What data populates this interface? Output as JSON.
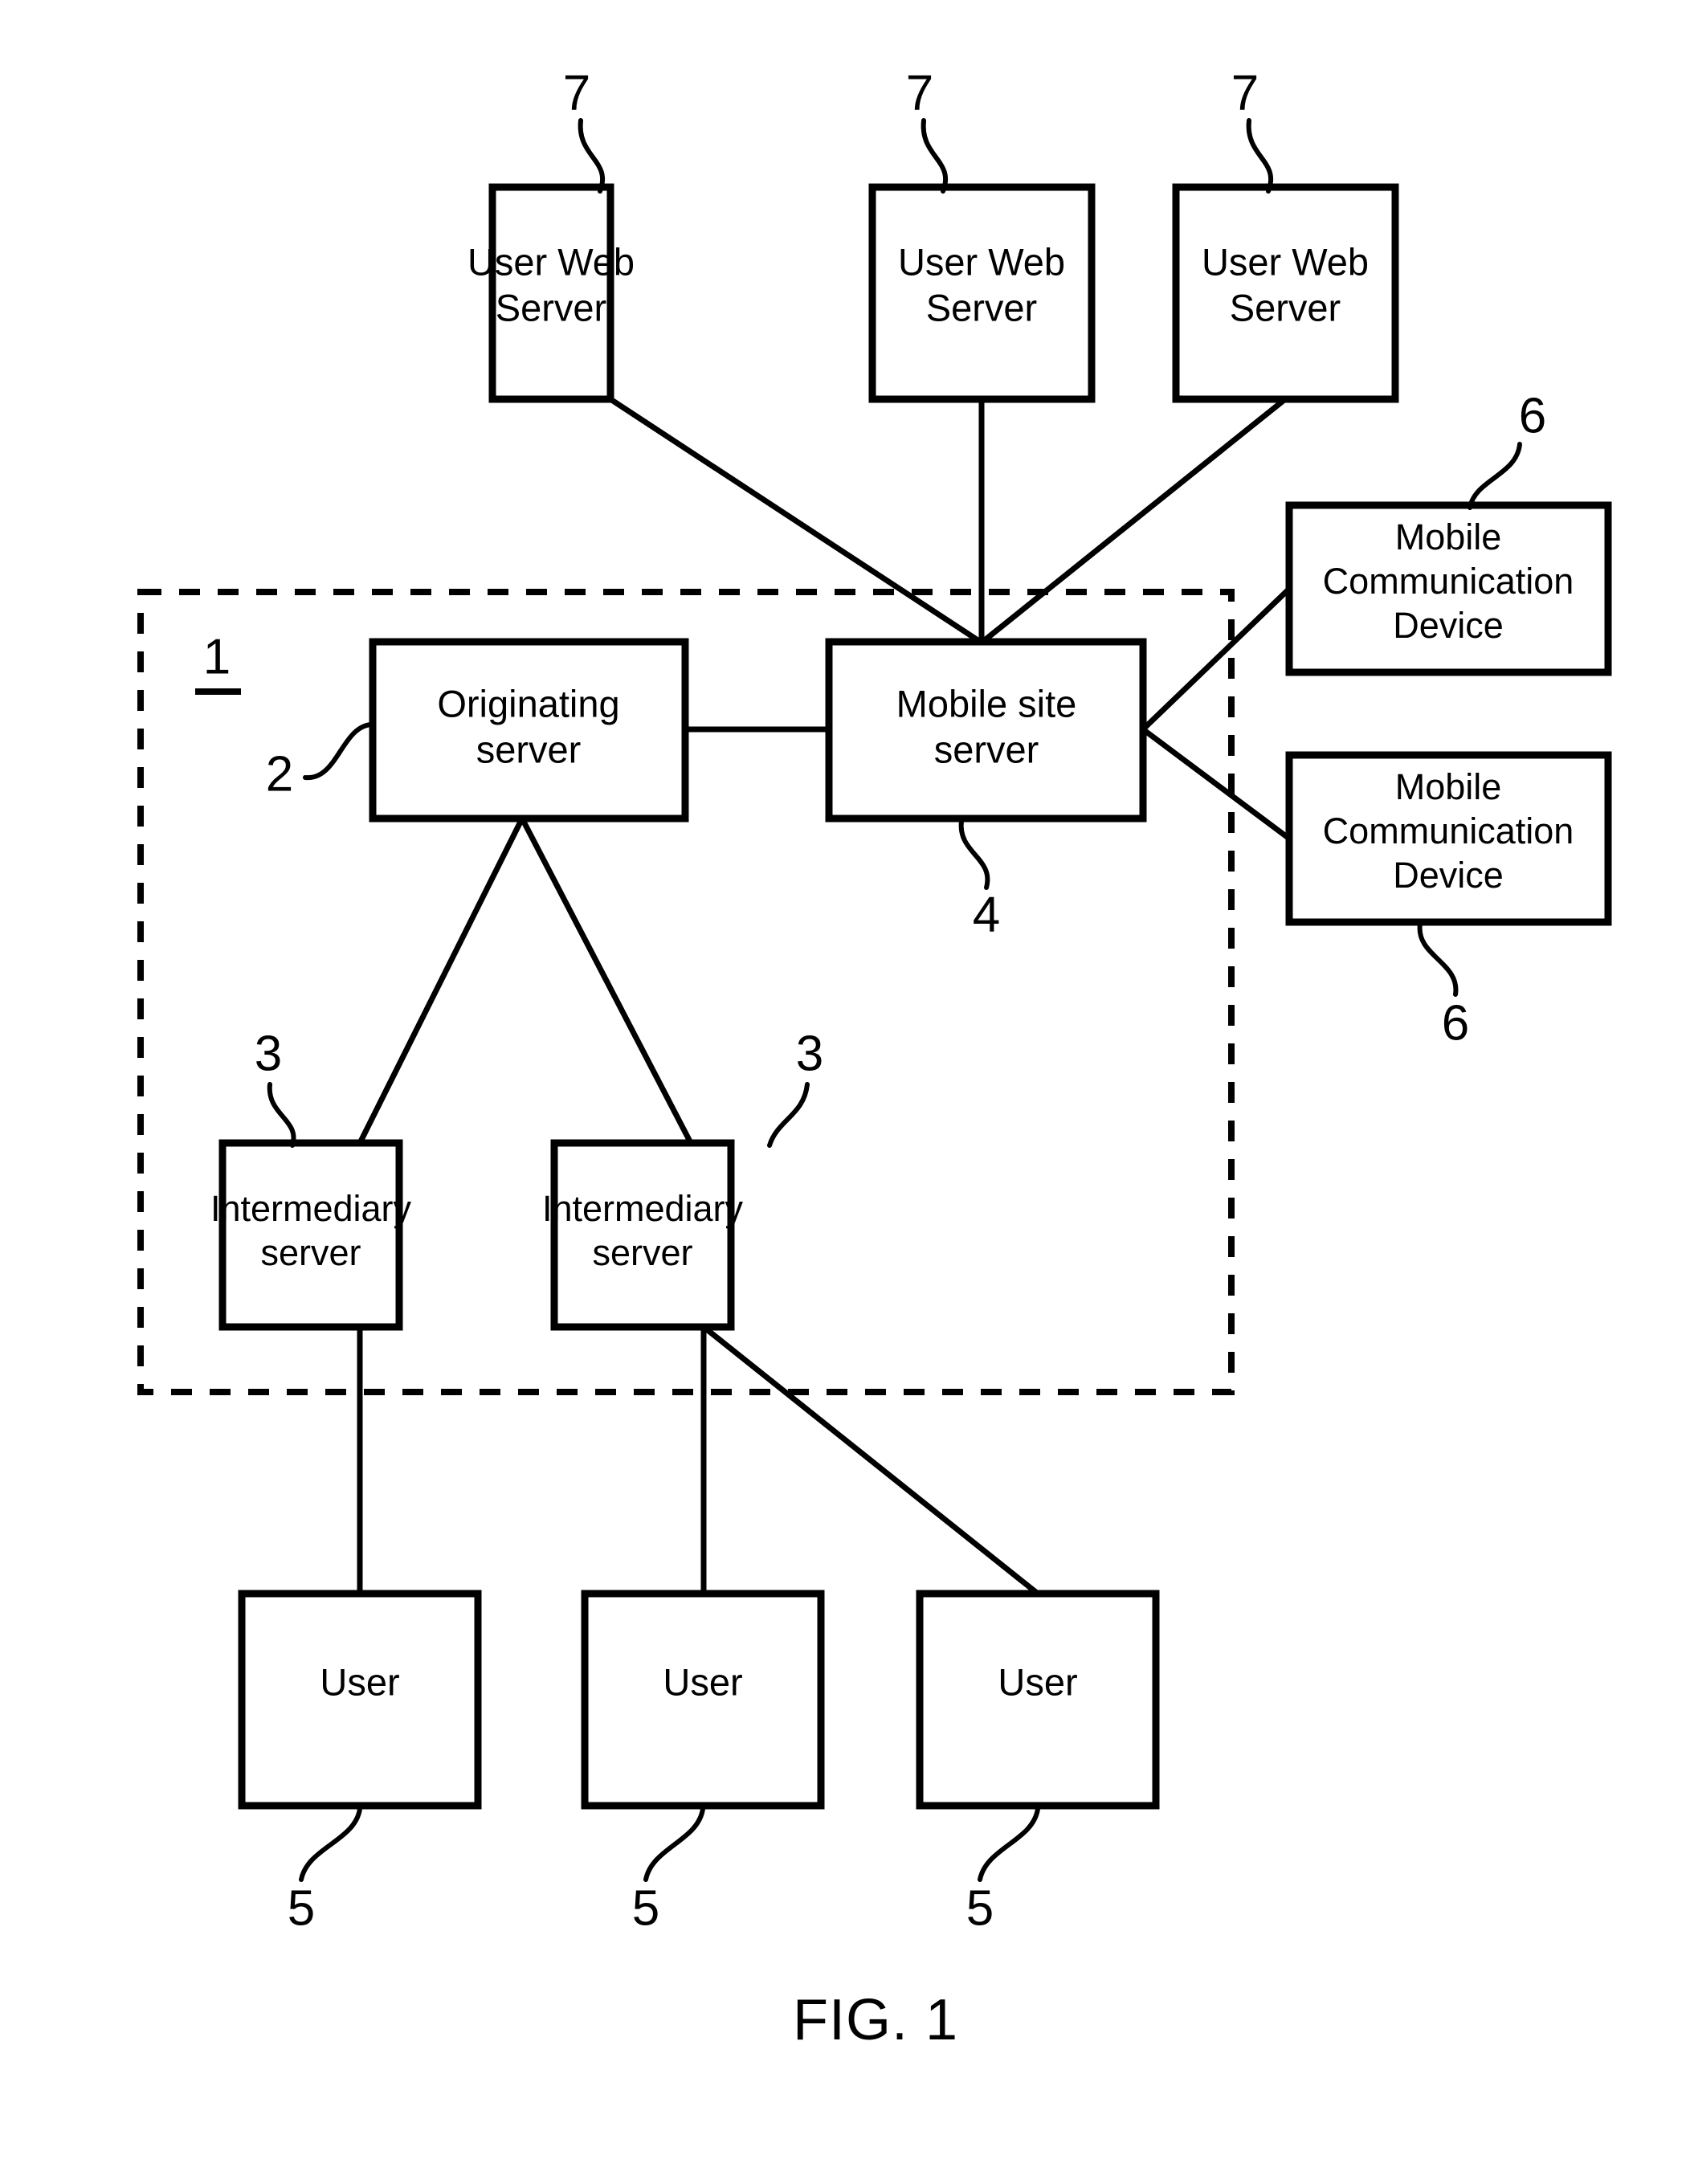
{
  "figure": {
    "caption": "FIG. 1",
    "system_ref": "1"
  },
  "nodes": {
    "user_web_servers": [
      {
        "line1": "User Web",
        "line2": "Server",
        "ref": "7"
      },
      {
        "line1": "User Web",
        "line2": "Server",
        "ref": "7"
      },
      {
        "line1": "User Web",
        "line2": "Server",
        "ref": "7"
      }
    ],
    "originating_server": {
      "line1": "Originating",
      "line2": "server",
      "ref": "2"
    },
    "mobile_site_server": {
      "line1": "Mobile site",
      "line2": "server",
      "ref": "4"
    },
    "mobile_communication_devices": [
      {
        "line1": "Mobile",
        "line2": "Communication",
        "line3": "Device",
        "ref": "6"
      },
      {
        "line1": "Mobile",
        "line2": "Communication",
        "line3": "Device",
        "ref": "6"
      }
    ],
    "intermediary_servers": [
      {
        "line1": "Intermediary",
        "line2": "server",
        "ref": "3"
      },
      {
        "line1": "Intermediary",
        "line2": "server",
        "ref": "3"
      }
    ],
    "users": [
      {
        "label": "User",
        "ref": "5"
      },
      {
        "label": "User",
        "ref": "5"
      },
      {
        "label": "User",
        "ref": "5"
      }
    ]
  },
  "colors": {
    "stroke": "#000000",
    "background": "#ffffff"
  }
}
